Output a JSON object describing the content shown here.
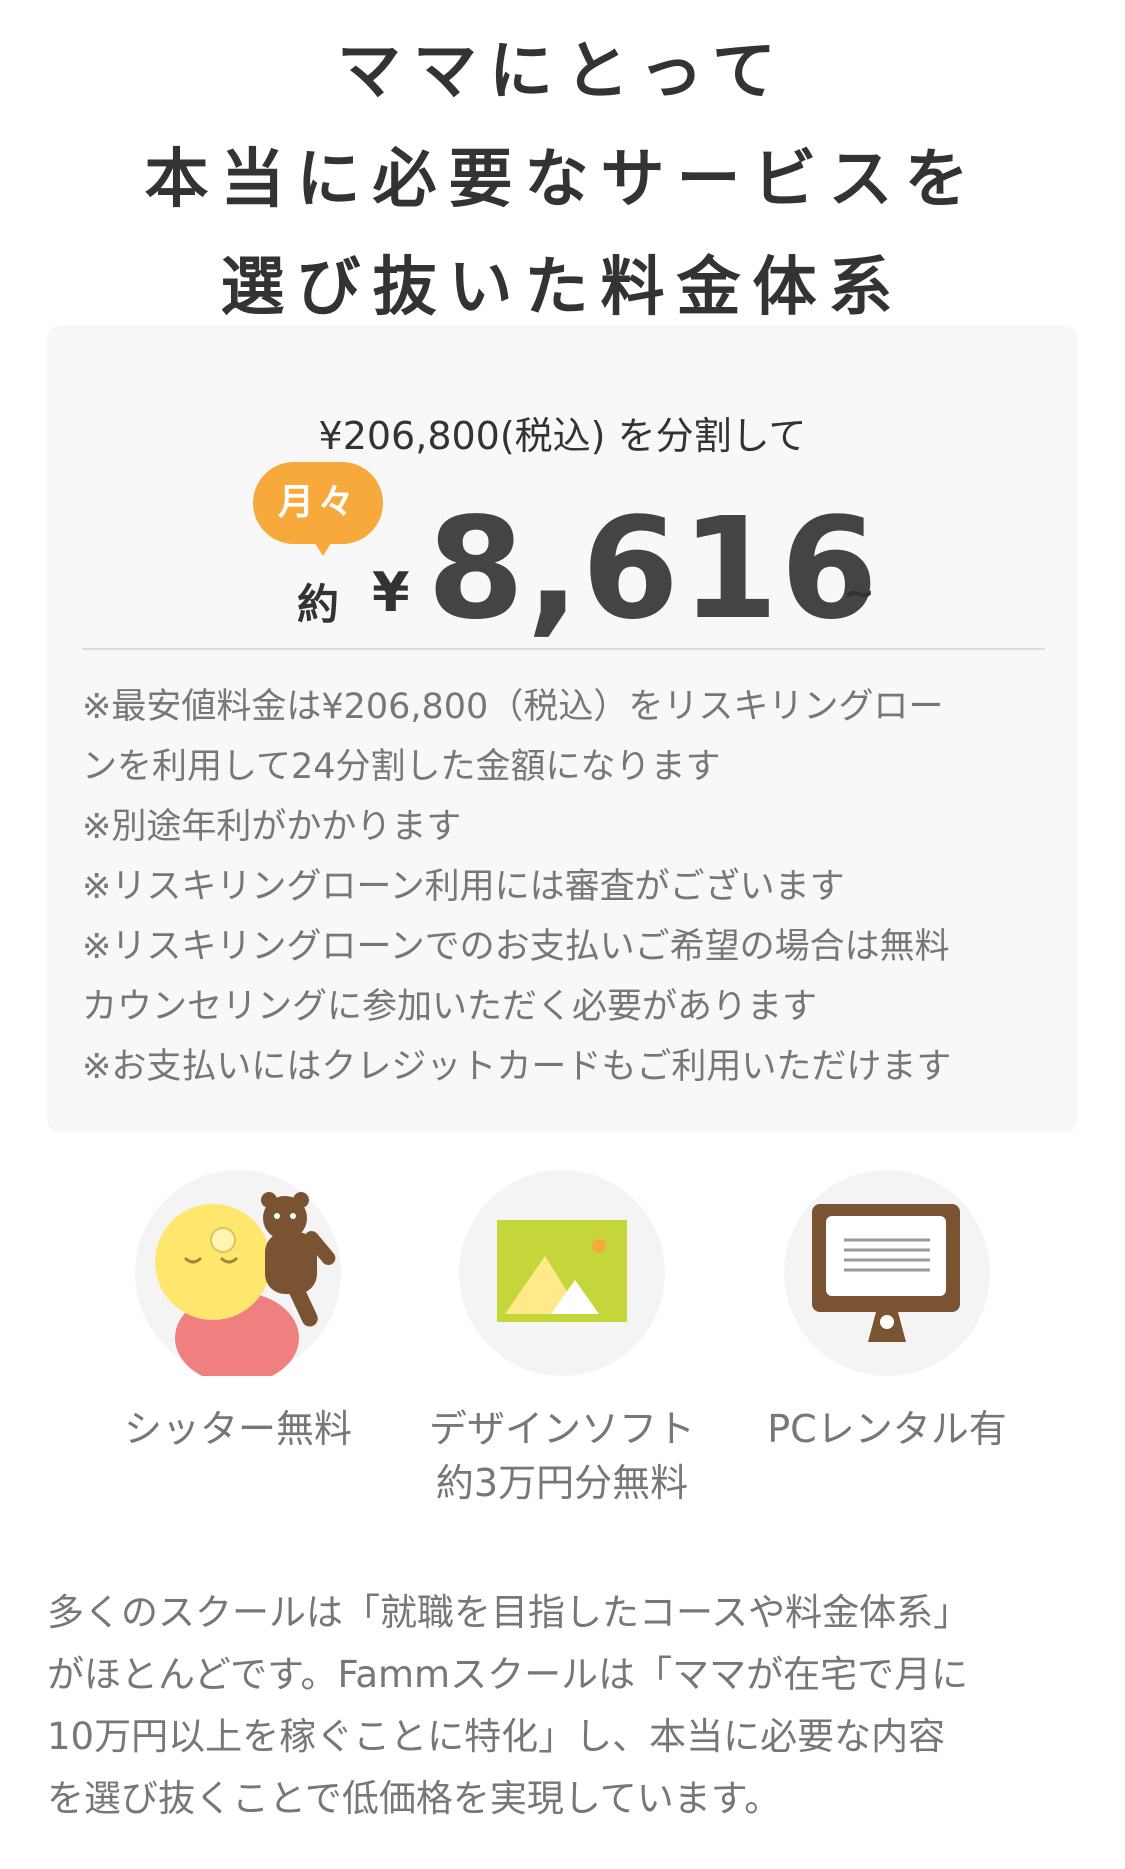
{
  "heading": {
    "line1": "ママにとって",
    "line2": "本当に必要なサービスを",
    "line3": "選び抜いた料金体系"
  },
  "price_card": {
    "intro": "¥206,800(税込) を分割して",
    "badge": "月々",
    "prefix": "約",
    "currency": "¥",
    "amount": "8,616",
    "suffix": "~",
    "notes": [
      "※最安値料金は¥206,800（税込）をリスキリングロー",
      "ンを利用して24分割した金額になります",
      "※別途年利がかかります",
      "※リスキリングローン利用には審査がございます",
      "※リスキリングローンでのお支払いご希望の場合は無料",
      "カウンセリングに参加いただく必要があります",
      "※お支払いにはクレジットカードもご利用いただけます"
    ]
  },
  "features": [
    {
      "icon": "baby-with-bear-icon",
      "label_line1": "シッター無料",
      "label_line2": ""
    },
    {
      "icon": "picture-icon",
      "label_line1": "デザインソフト",
      "label_line2": "約3万円分無料"
    },
    {
      "icon": "monitor-icon",
      "label_line1": "PCレンタル有",
      "label_line2": ""
    }
  ],
  "description": {
    "lines": [
      "多くのスクールは「就職を目指したコースや料金体系」",
      "がほとんどです。Fammスクールは「ママが在宅で月に",
      "10万円以上を稼ぐことに特化」し、本当に必要な内容",
      "を選び抜くことで低価格を実現しています。"
    ]
  },
  "colors": {
    "accent_orange": "#f7a93b",
    "card_bg": "#f8f8f8",
    "icon_yellow_green": "#c5d63a",
    "icon_brown": "#7a5332",
    "icon_pink": "#f08080",
    "icon_yellow": "#ffe66d"
  }
}
